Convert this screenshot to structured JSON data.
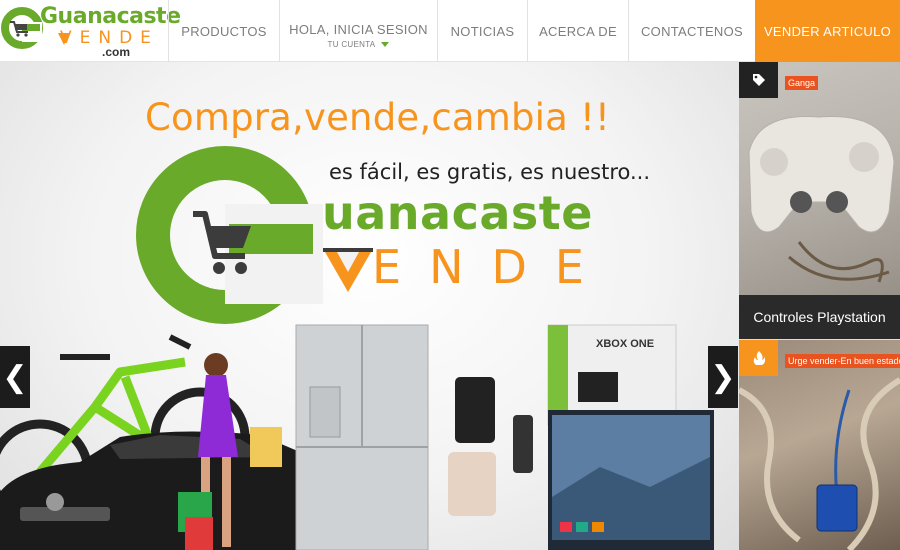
{
  "header": {
    "logo": {
      "word_top": "Guanacaste",
      "word_bottom": "VENDE",
      "domain": ".com"
    },
    "nav": [
      {
        "label": "PRODUCTOS",
        "sub": ""
      },
      {
        "label": "HOLA, INICIA SESION",
        "sub": "TU CUENTA"
      },
      {
        "label": "NOTICIAS",
        "sub": ""
      },
      {
        "label": "ACERCA DE",
        "sub": ""
      },
      {
        "label": "CONTACTENOS",
        "sub": ""
      }
    ],
    "sell_button": "VENDER ARTICULO"
  },
  "hero": {
    "headline": "Compra,vende,cambia !!",
    "tagline": "es fácil, es gratis, es nuestro...",
    "brand_top": "uanacaste",
    "brand_bottom": "ENDE",
    "xbox_label": "XBOX ONE"
  },
  "carousel": {
    "prev_icon": "chevron-left-icon",
    "next_icon": "chevron-right-icon"
  },
  "side_cards": [
    {
      "icon": "tag-icon",
      "badge": "Ganga",
      "title": "Controles Playstation"
    },
    {
      "icon": "flame-icon",
      "badge": "Urge vender-En buen estado-N",
      "title": ""
    }
  ],
  "colors": {
    "brand_green": "#6aaa2b",
    "brand_orange": "#f7941d",
    "badge_red": "#e8531f",
    "dark": "#1c1c1c"
  }
}
